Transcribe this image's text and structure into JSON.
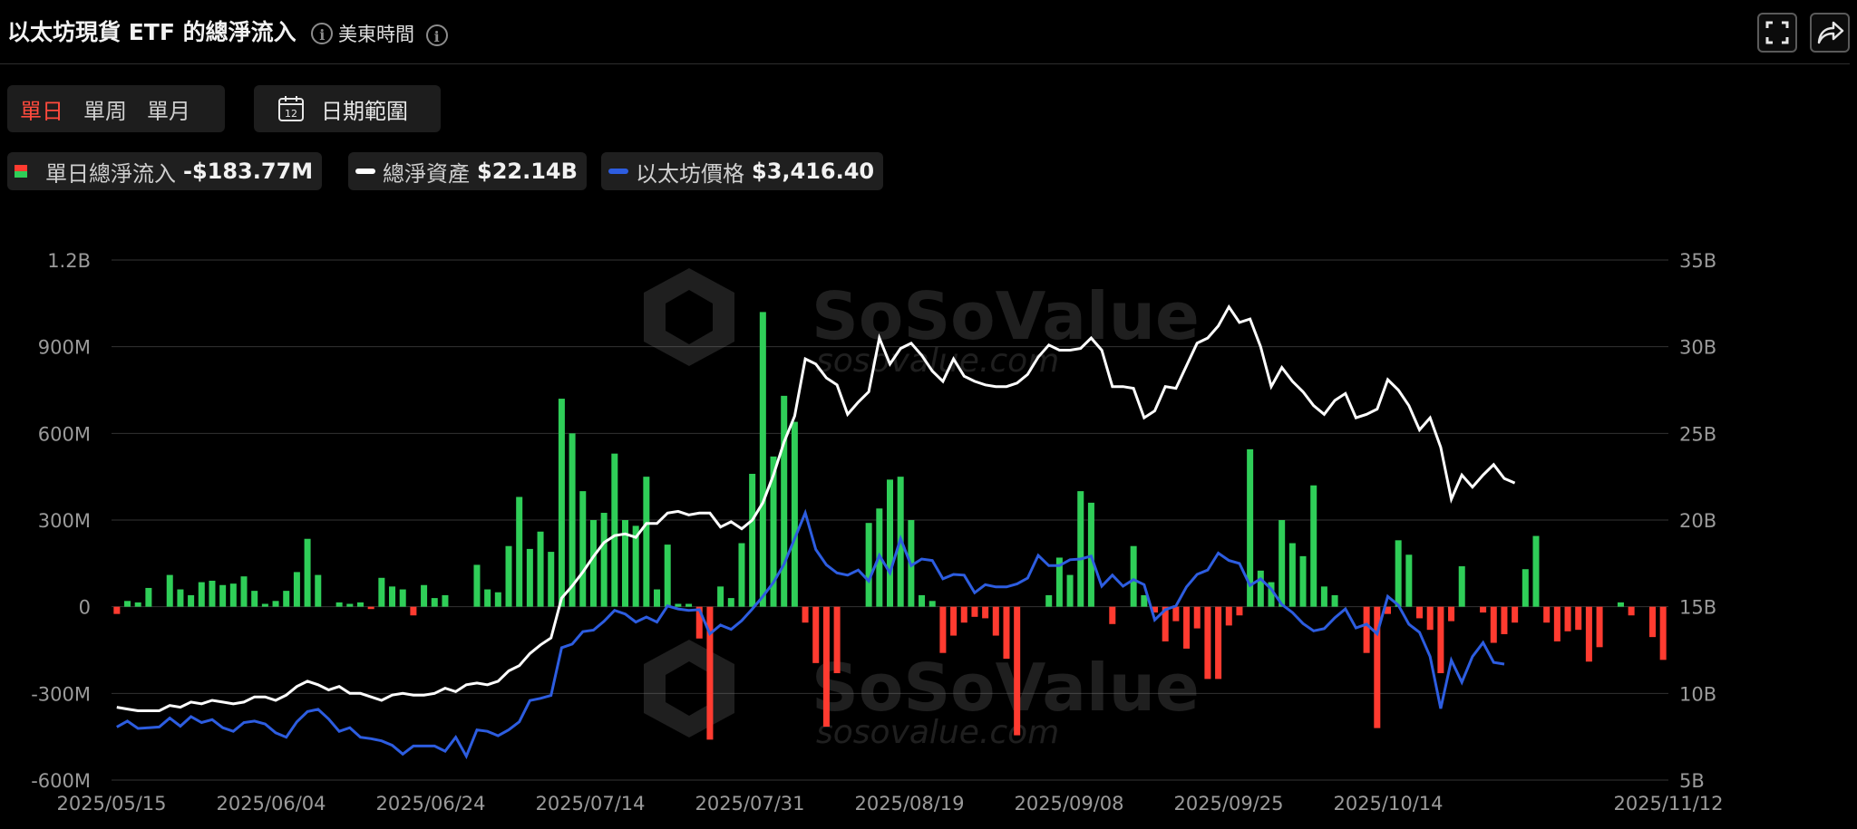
{
  "header": {
    "title": "以太坊現貨 ETF 的總淨流入",
    "timezone": "美東時間"
  },
  "toolbar": {
    "periods": [
      "單日",
      "單周",
      "單月"
    ],
    "active_period": "單日",
    "date_range_label": "日期範圍",
    "calendar_day": "12"
  },
  "legend": [
    {
      "label": "單日總淨流入",
      "value": "-$183.77M"
    },
    {
      "label": "總淨資產",
      "value": "$22.14B"
    },
    {
      "label": "以太坊價格",
      "value": "$3,416.40"
    }
  ],
  "watermark": {
    "brand": "SoSoValue",
    "url": "sosovalue.com"
  },
  "colors": {
    "inflow": "#2fce58",
    "outflow": "#ff3b30",
    "net_assets_line": "#ffffff",
    "eth_price_line": "#2d5de0",
    "active_period": "#ff4a3d",
    "background": "#000000"
  },
  "icons": [
    "info-icon",
    "calendar-icon",
    "fullscreen-icon",
    "share-icon"
  ],
  "chart_data": {
    "type": "bar",
    "x_tick_labels": [
      "2025/05/15",
      "2025/06/04",
      "2025/06/24",
      "2025/07/14",
      "2025/07/31",
      "2025/08/19",
      "2025/09/08",
      "2025/09/25",
      "2025/10/14",
      "2025/11/12"
    ],
    "y_left_ticks": [
      "1.2B",
      "900M",
      "600M",
      "300M",
      "0",
      "-300M",
      "-600M"
    ],
    "y_left_range": [
      -600,
      1200
    ],
    "y_right_ticks": [
      "35B",
      "30B",
      "25B",
      "20B",
      "15B",
      "10B",
      "5B"
    ],
    "y_right_range": [
      5,
      35
    ],
    "grid": true,
    "series": [
      {
        "name": "單日總淨流入",
        "unit": "M USD",
        "values": [
          -25,
          20,
          15,
          65,
          0,
          110,
          60,
          40,
          85,
          90,
          75,
          80,
          105,
          55,
          10,
          20,
          55,
          120,
          235,
          110,
          0,
          15,
          10,
          15,
          -8,
          100,
          70,
          60,
          -30,
          75,
          30,
          40,
          0,
          0,
          145,
          60,
          50,
          210,
          380,
          200,
          260,
          190,
          720,
          600,
          400,
          300,
          325,
          530,
          300,
          280,
          450,
          60,
          215,
          10,
          10,
          -110,
          -460,
          70,
          30,
          220,
          460,
          1020,
          520,
          730,
          640,
          -55,
          -195,
          -415,
          -230,
          0,
          0,
          290,
          340,
          440,
          450,
          300,
          40,
          20,
          -160,
          -100,
          -55,
          -35,
          -40,
          -100,
          -180,
          -445,
          0,
          0,
          40,
          170,
          110,
          400,
          360,
          0,
          -60,
          0,
          210,
          40,
          -20,
          -120,
          -50,
          -145,
          -75,
          -250,
          -250,
          -65,
          -30,
          545,
          125,
          85,
          300,
          220,
          175,
          420,
          70,
          40,
          0,
          0,
          -160,
          -420,
          -25,
          230,
          180,
          -40,
          -80,
          -230,
          -50,
          140,
          0,
          -20,
          -125,
          -95,
          -55,
          130,
          245,
          -55,
          -120,
          -85,
          -80,
          -190,
          -140,
          0,
          15,
          -30,
          0,
          -105,
          -184
        ]
      },
      {
        "name": "總淨資產",
        "unit": "B USD",
        "values": [
          9.2,
          9.1,
          9.0,
          9.0,
          9.0,
          9.3,
          9.2,
          9.5,
          9.4,
          9.6,
          9.5,
          9.4,
          9.5,
          9.8,
          9.8,
          9.6,
          9.9,
          10.4,
          10.7,
          10.5,
          10.2,
          10.4,
          10.0,
          10.0,
          9.8,
          9.6,
          9.9,
          10.0,
          9.9,
          9.9,
          10.0,
          10.3,
          10.1,
          10.5,
          10.6,
          10.5,
          10.7,
          11.3,
          11.6,
          12.3,
          12.8,
          13.2,
          15.5,
          16.2,
          17.0,
          17.9,
          18.7,
          19.1,
          19.2,
          19.0,
          19.8,
          19.8,
          20.4,
          20.5,
          20.3,
          20.4,
          20.4,
          19.6,
          19.9,
          19.5,
          20.0,
          21.0,
          22.6,
          24.5,
          26.0,
          29.3,
          29.0,
          28.2,
          27.8,
          26.1,
          26.8,
          27.4,
          30.5,
          29.0,
          29.9,
          30.2,
          29.5,
          28.6,
          28.0,
          29.3,
          28.3,
          28.0,
          27.8,
          27.7,
          27.7,
          27.9,
          28.4,
          29.4,
          30.1,
          29.8,
          29.8,
          29.9,
          30.5,
          29.8,
          27.7,
          27.7,
          27.6,
          25.9,
          26.3,
          27.7,
          27.6,
          28.9,
          30.2,
          30.5,
          31.2,
          32.3,
          31.4,
          31.6,
          30.0,
          27.7,
          28.8,
          28.0,
          27.4,
          26.6,
          26.1,
          26.9,
          27.3,
          25.9,
          26.1,
          26.4,
          28.1,
          27.5,
          26.6,
          25.2,
          25.9,
          24.2,
          21.2,
          22.6,
          21.9,
          22.6,
          23.2,
          22.4,
          22.14
        ]
      },
      {
        "name": "以太坊價格",
        "unit": "USD",
        "values": [
          2560,
          2640,
          2540,
          2550,
          2560,
          2680,
          2570,
          2700,
          2620,
          2660,
          2550,
          2500,
          2620,
          2640,
          2600,
          2480,
          2420,
          2630,
          2770,
          2800,
          2670,
          2500,
          2550,
          2420,
          2400,
          2370,
          2310,
          2190,
          2300,
          2300,
          2300,
          2230,
          2420,
          2160,
          2520,
          2500,
          2440,
          2520,
          2630,
          2920,
          2950,
          2990,
          3640,
          3690,
          3860,
          3880,
          4000,
          4150,
          4100,
          3990,
          4060,
          3990,
          4210,
          4170,
          4150,
          4160,
          3830,
          3950,
          3890,
          4010,
          4170,
          4340,
          4530,
          4780,
          5130,
          5480,
          4980,
          4770,
          4660,
          4630,
          4700,
          4550,
          4900,
          4660,
          5130,
          4760,
          4850,
          4830,
          4580,
          4640,
          4630,
          4390,
          4500,
          4470,
          4470,
          4510,
          4590,
          4900,
          4760,
          4760,
          4840,
          4850,
          4890,
          4480,
          4630,
          4480,
          4570,
          4500,
          4020,
          4160,
          4210,
          4470,
          4640,
          4700,
          4930,
          4830,
          4790,
          4490,
          4580,
          4440,
          4230,
          4120,
          3970,
          3870,
          3900,
          4050,
          4170,
          3910,
          3960,
          3830,
          4340,
          4220,
          3960,
          3850,
          3520,
          2810,
          3470,
          3170,
          3520,
          3710,
          3440,
          3416.4
        ]
      }
    ]
  }
}
